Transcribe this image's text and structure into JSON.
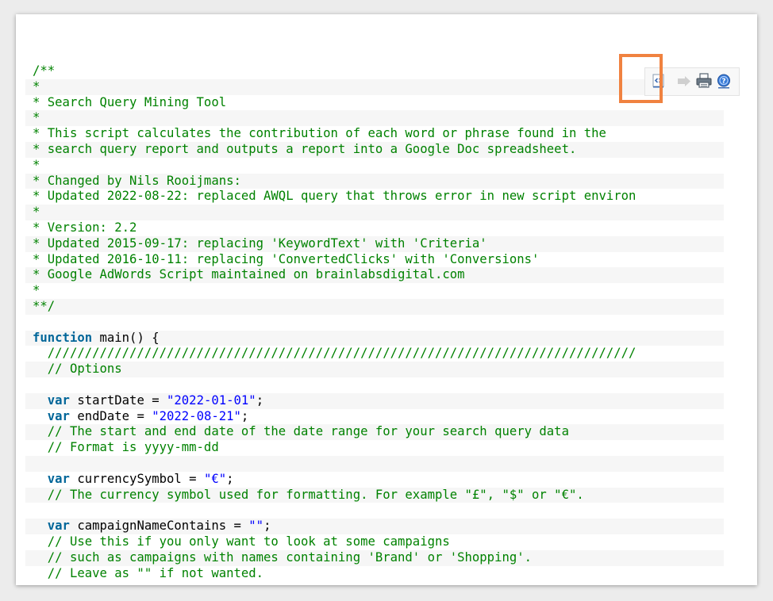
{
  "toolbar": {
    "icons": [
      "view-source-icon",
      "copy-icon",
      "print-icon",
      "help-icon"
    ],
    "highlight_color": "#f08240"
  },
  "colors": {
    "comment": "#008200",
    "keyword": "#006699",
    "string": "#0000ff",
    "alt_row": "#f6f6f6"
  },
  "code": {
    "l1": "/**",
    "l2": "*",
    "l3": "* Search Query Mining Tool",
    "l4": "*",
    "l5": "* This script calculates the contribution of each word or phrase found in the",
    "l6": "* search query report and outputs a report into a Google Doc spreadsheet.",
    "l7": "*",
    "l8": "* Changed by Nils Rooijmans:",
    "l9": "* Updated 2022-08-22: replaced AWQL query that throws error in new script environ",
    "l10": "*",
    "l11": "* Version: 2.2",
    "l12": "* Updated 2015-09-17: replacing 'KeywordText' with 'Criteria'",
    "l13": "* Updated 2016-10-11: replacing 'ConvertedClicks' with 'Conversions'",
    "l14": "* Google AdWords Script maintained on brainlabsdigital.com",
    "l15": "*",
    "l16": "**/",
    "l17": "",
    "l18_kw": "function",
    "l18_rest": " main() {",
    "l19": "  ///////////////////////////////////////////////////////////////////////////////",
    "l20": "  // Options",
    "l21": "",
    "l22_ind": "  ",
    "l22_kw": "var",
    "l22_mid": " startDate = ",
    "l22_str": "\"2022-01-01\"",
    "l22_end": ";",
    "l23_ind": "  ",
    "l23_kw": "var",
    "l23_mid": " endDate = ",
    "l23_str": "\"2022-08-21\"",
    "l23_end": ";",
    "l24": "  // The start and end date of the date range for your search query data",
    "l25": "  // Format is yyyy-mm-dd",
    "l26": "",
    "l27_ind": "  ",
    "l27_kw": "var",
    "l27_mid": " currencySymbol = ",
    "l27_str": "\"€\"",
    "l27_end": ";",
    "l28": "  // The currency symbol used for formatting. For example \"£\", \"$\" or \"€\".",
    "l29": "",
    "l30_ind": "  ",
    "l30_kw": "var",
    "l30_mid": " campaignNameContains = ",
    "l30_str": "\"\"",
    "l30_end": ";",
    "l31": "  // Use this if you only want to look at some campaigns",
    "l32": "  // such as campaigns with names containing 'Brand' or 'Shopping'.",
    "l33": "  // Leave as \"\" if not wanted."
  }
}
